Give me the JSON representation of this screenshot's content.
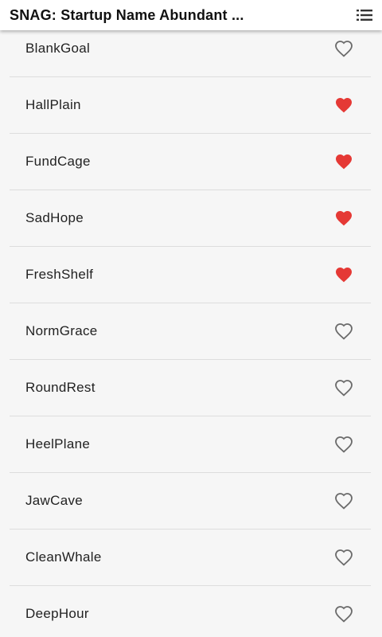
{
  "appbar": {
    "title": "SNAG: Startup Name Abundant ...",
    "menu_icon": "list-icon"
  },
  "colors": {
    "favorite": "#e53935",
    "outline": "#6b6b6b"
  },
  "names": [
    {
      "label": "BlankGoal",
      "favorite": false
    },
    {
      "label": "HallPlain",
      "favorite": true
    },
    {
      "label": "FundCage",
      "favorite": true
    },
    {
      "label": "SadHope",
      "favorite": true
    },
    {
      "label": "FreshShelf",
      "favorite": true
    },
    {
      "label": "NormGrace",
      "favorite": false
    },
    {
      "label": "RoundRest",
      "favorite": false
    },
    {
      "label": "HeelPlane",
      "favorite": false
    },
    {
      "label": "JawCave",
      "favorite": false
    },
    {
      "label": "CleanWhale",
      "favorite": false
    },
    {
      "label": "DeepHour",
      "favorite": false
    }
  ]
}
